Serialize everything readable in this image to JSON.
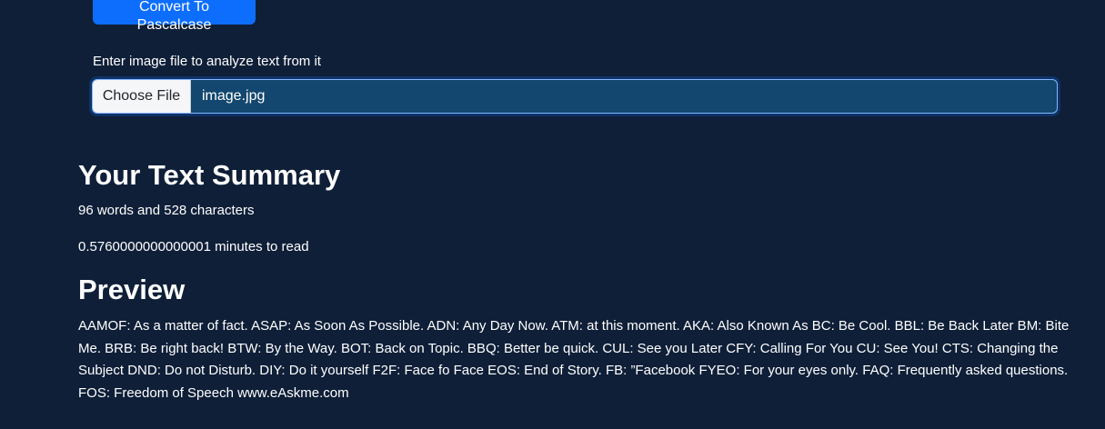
{
  "toolbar": {
    "convert_label": "Convert To Pascalcase"
  },
  "file_upload": {
    "label": "Enter image file to analyze text from it",
    "choose_button": "Choose File",
    "file_name": "image.jpg"
  },
  "summary": {
    "title": "Your Text Summary",
    "counts": "96 words and 528 characters",
    "read_time": "0.5760000000000001 minutes to read"
  },
  "preview": {
    "title": "Preview",
    "text": "AAMOF: As a matter of fact. ASAP: As Soon As Possible. ADN: Any Day Now. ATM: at this moment. AKA: Also Known As BC: Be Cool. BBL: Be Back Later BM: Bite Me. BRB: Be right back! BTW: By the Way. BOT: Back on Topic. BBQ: Better be quick. CUL: See you Later CFY: Calling For You CU: See You! CTS: Changing the Subject DND: Do not Disturb. DIY: Do it yourself F2F: Face fo Face EOS: End of Story. FB: ”Facebook FYEO: For your eyes only. FAQ: Frequently asked questions. FOS: Freedom of Speech www.eAskme.com"
  },
  "colors": {
    "background": "#0f1f38",
    "primary": "#0d6efd",
    "input_fill": "#13476f"
  }
}
